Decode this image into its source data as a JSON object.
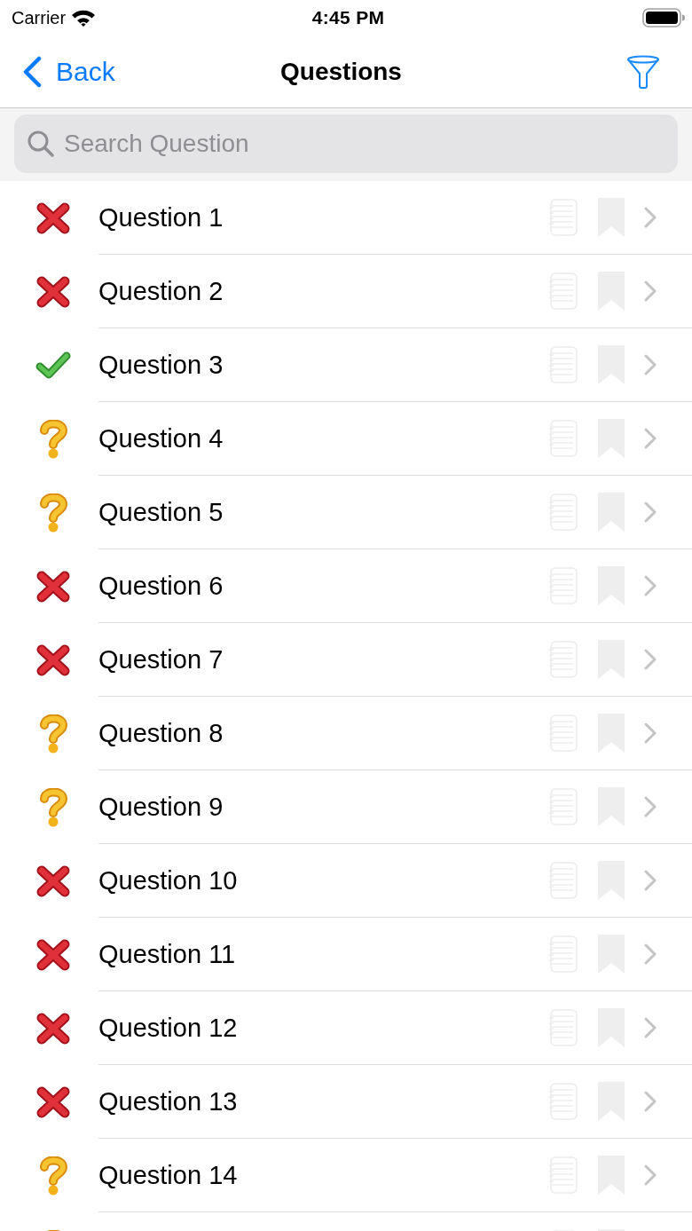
{
  "status_bar": {
    "carrier": "Carrier",
    "time": "4:45 PM"
  },
  "nav_bar": {
    "back_label": "Back",
    "title": "Questions"
  },
  "search": {
    "placeholder": "Search Question"
  },
  "questions": [
    {
      "label": "Question 1",
      "kind": "wrong",
      "has_note": false,
      "bookmarked": false
    },
    {
      "label": "Question 2",
      "kind": "wrong",
      "has_note": false,
      "bookmarked": false
    },
    {
      "label": "Question 3",
      "kind": "correct",
      "has_note": false,
      "bookmarked": false
    },
    {
      "label": "Question 4",
      "kind": "unanswered",
      "has_note": false,
      "bookmarked": false
    },
    {
      "label": "Question 5",
      "kind": "unanswered",
      "has_note": false,
      "bookmarked": false
    },
    {
      "label": "Question 6",
      "kind": "wrong",
      "has_note": false,
      "bookmarked": false
    },
    {
      "label": "Question 7",
      "kind": "wrong",
      "has_note": false,
      "bookmarked": false
    },
    {
      "label": "Question 8",
      "kind": "unanswered",
      "has_note": false,
      "bookmarked": false
    },
    {
      "label": "Question 9",
      "kind": "unanswered",
      "has_note": false,
      "bookmarked": false
    },
    {
      "label": "Question 10",
      "kind": "wrong",
      "has_note": false,
      "bookmarked": false
    },
    {
      "label": "Question 11",
      "kind": "wrong",
      "has_note": false,
      "bookmarked": false
    },
    {
      "label": "Question 12",
      "kind": "wrong",
      "has_note": false,
      "bookmarked": false
    },
    {
      "label": "Question 13",
      "kind": "wrong",
      "has_note": false,
      "bookmarked": false
    },
    {
      "label": "Question 14",
      "kind": "unanswered",
      "has_note": false,
      "bookmarked": false
    },
    {
      "kind": "unanswered",
      "has_note": false,
      "bookmarked": false
    }
  ]
}
